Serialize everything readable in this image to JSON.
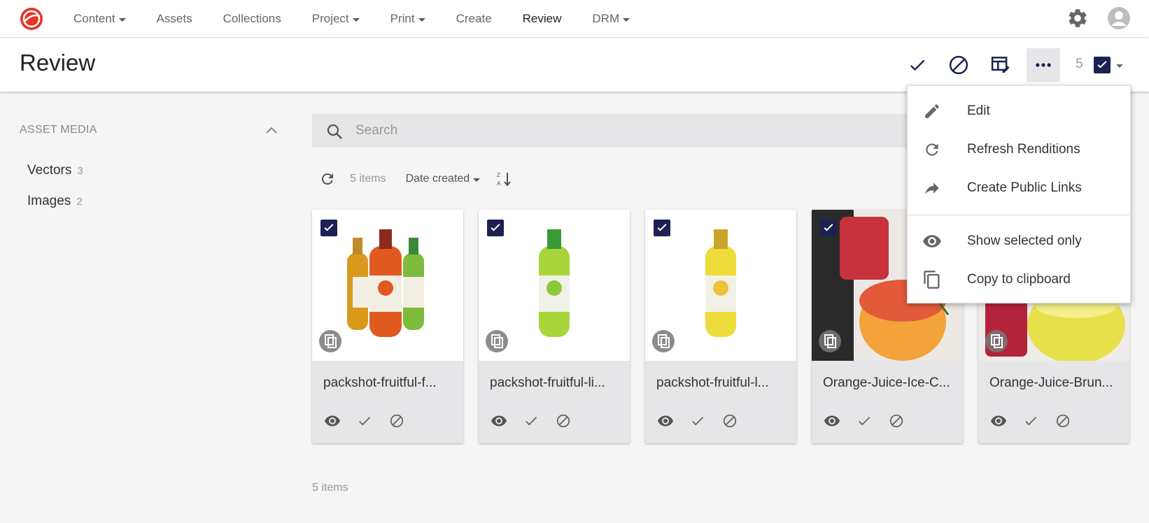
{
  "nav": {
    "items": [
      {
        "label": "Content",
        "dropdown": true
      },
      {
        "label": "Assets",
        "dropdown": false
      },
      {
        "label": "Collections",
        "dropdown": false
      },
      {
        "label": "Project",
        "dropdown": true
      },
      {
        "label": "Print",
        "dropdown": true
      },
      {
        "label": "Create",
        "dropdown": false
      },
      {
        "label": "Review",
        "dropdown": false,
        "active": true
      },
      {
        "label": "DRM",
        "dropdown": true
      }
    ],
    "logo_color": "#e8352a",
    "icons": [
      "settings-gear-icon",
      "user-avatar-icon"
    ]
  },
  "page": {
    "title": "Review",
    "selected_count": "5"
  },
  "sidebar": {
    "heading": "ASSET MEDIA",
    "items": [
      {
        "label": "Vectors",
        "count": "3"
      },
      {
        "label": "Images",
        "count": "2"
      }
    ]
  },
  "search": {
    "placeholder": "Search",
    "value": ""
  },
  "toolbar": {
    "items_count": "5 items",
    "sort_label": "Date created"
  },
  "assets": [
    {
      "name": "packshot-fruitful-f...",
      "checked": true,
      "thumb": "three-bottles"
    },
    {
      "name": "packshot-fruitful-li...",
      "checked": true,
      "thumb": "lime-bottle"
    },
    {
      "name": "packshot-fruitful-l...",
      "checked": true,
      "thumb": "lemon-bottle"
    },
    {
      "name": "Orange-Juice-Ice-C...",
      "checked": true,
      "thumb": "juice-photo"
    },
    {
      "name": "Orange-Juice-Brun...",
      "checked": true,
      "thumb": "juice-photo-2"
    }
  ],
  "footer": {
    "items_count": "5 items"
  },
  "menu": {
    "items": [
      {
        "label": "Edit",
        "icon": "pencil-icon"
      },
      {
        "label": "Refresh Renditions",
        "icon": "refresh-icon"
      },
      {
        "label": "Create Public Links",
        "icon": "share-arrow-icon"
      },
      {
        "label": "Show selected only",
        "icon": "eye-icon"
      },
      {
        "label": "Copy to clipboard",
        "icon": "copy-icon"
      }
    ]
  },
  "colors": {
    "accent_navy": "#1d2152",
    "card_bg": "#e6e6e9",
    "page_bg": "#f5f5f5"
  }
}
